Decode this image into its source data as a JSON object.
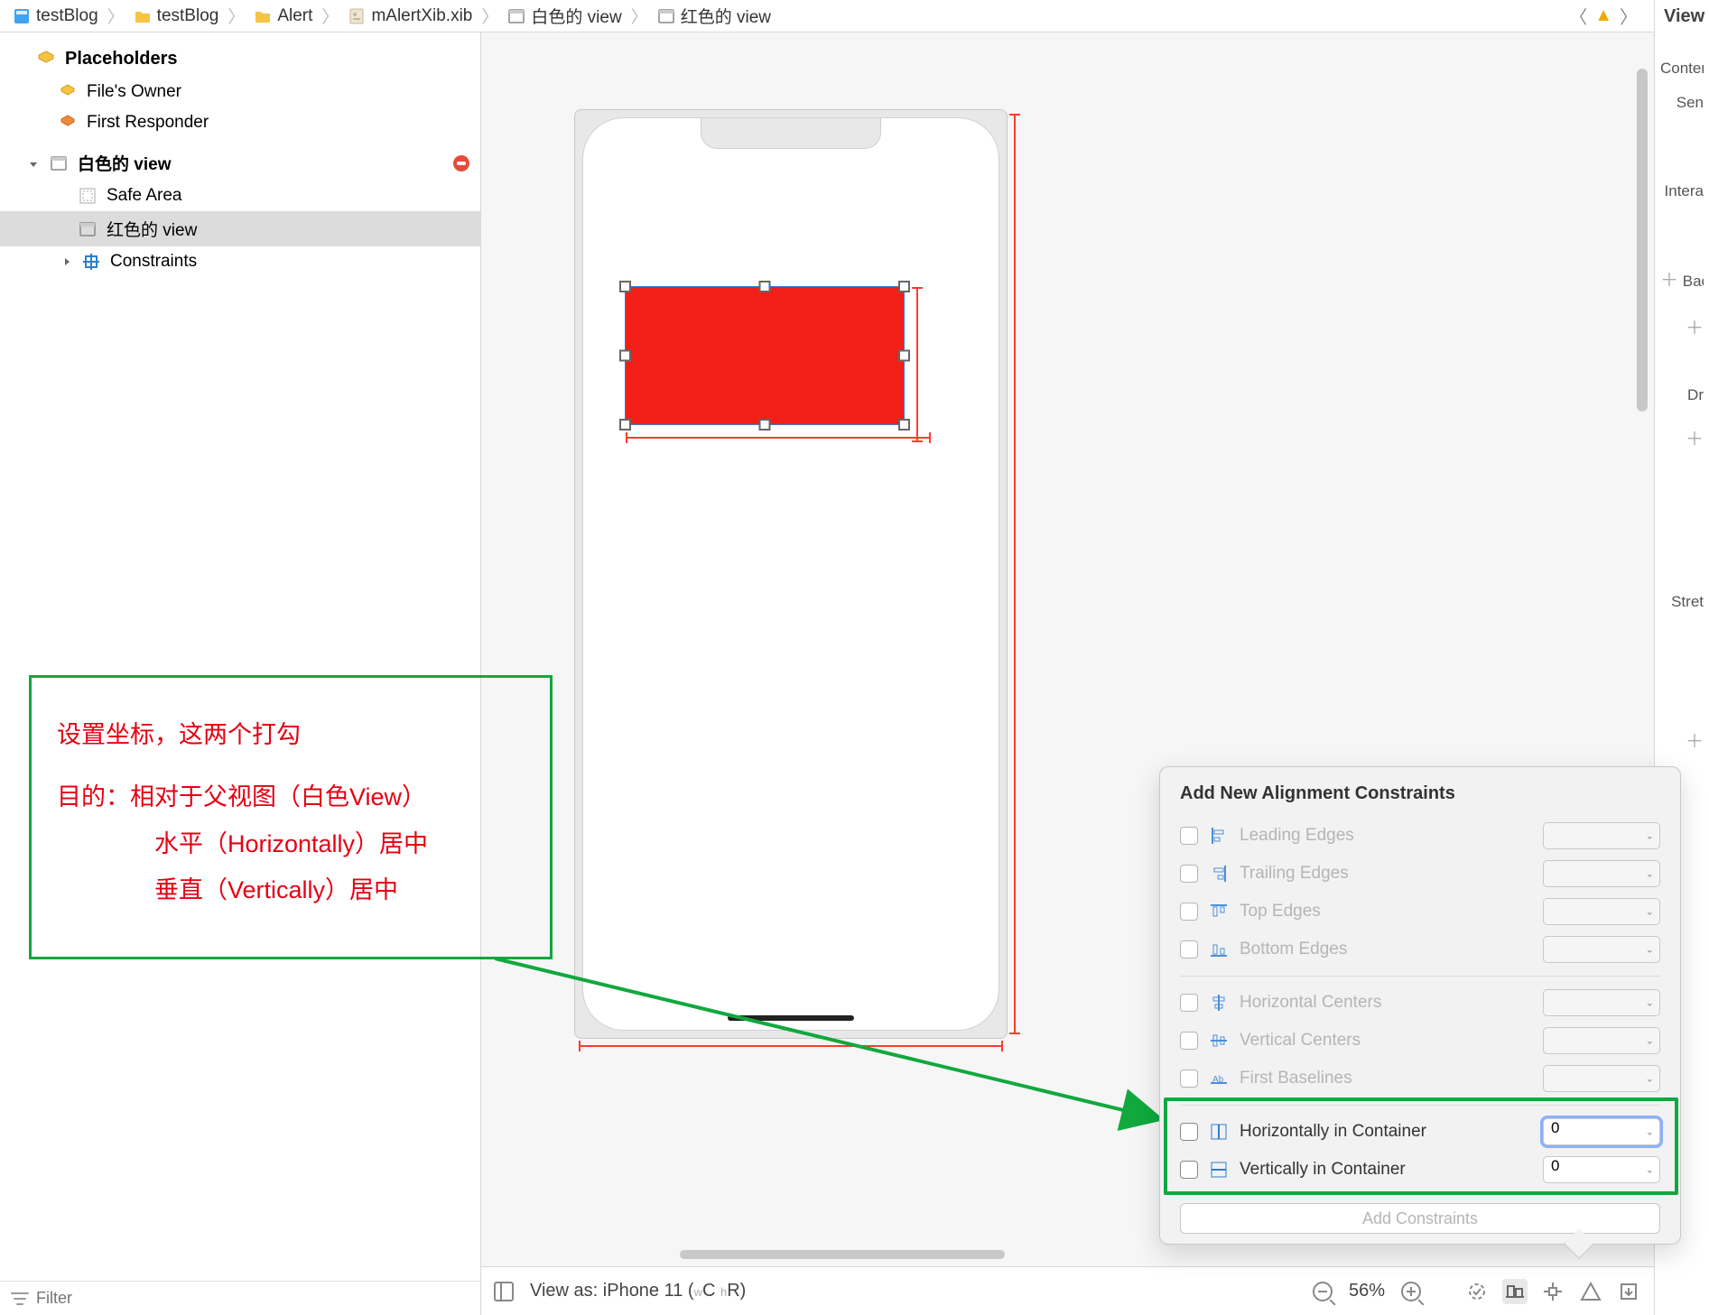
{
  "breadcrumb": {
    "items": [
      {
        "label": "testBlog",
        "kind": "project-icon"
      },
      {
        "label": "testBlog",
        "kind": "folder-icon"
      },
      {
        "label": "Alert",
        "kind": "folder-icon"
      },
      {
        "label": "mAlertXib.xib",
        "kind": "xib-icon"
      },
      {
        "label": "白色的 view",
        "kind": "view-icon"
      },
      {
        "label": "红色的 view",
        "kind": "view-icon"
      }
    ]
  },
  "outline": {
    "placeholders_label": "Placeholders",
    "files_owner": "File's Owner",
    "first_responder": "First Responder",
    "root_view": "白色的 view",
    "safe_area": "Safe Area",
    "red_view": "红色的 view",
    "constraints": "Constraints",
    "filter_placeholder": "Filter"
  },
  "canvas_bottom": {
    "view_as": "View as: iPhone 11 (",
    "w": "w",
    "c": "C ",
    "h": "h",
    "r": "R)",
    "zoom": "56%"
  },
  "annotation": {
    "l1": "设置坐标，这两个打勾",
    "l2": "目的：相对于父视图（白色View）",
    "l3": "水平（Horizontally）居中",
    "l4": "垂直（Vertically）居中"
  },
  "popover": {
    "title": "Add New Alignment Constraints",
    "leading": "Leading Edges",
    "trailing": "Trailing Edges",
    "top": "Top Edges",
    "bottom": "Bottom Edges",
    "hcenter": "Horizontal Centers",
    "vcenter": "Vertical Centers",
    "baseline": "First Baselines",
    "hcontainer": "Horizontally in Container",
    "vcontainer": "Vertically in Container",
    "hcontainer_val": "0",
    "vcontainer_val": "0",
    "add_btn": "Add Constraints"
  },
  "rightpanel": {
    "title": "View",
    "content": "Content",
    "sem": "Sen",
    "inter": "Intera",
    "backg": "Backg",
    "dr": "Dr",
    "stret": "Stret"
  }
}
